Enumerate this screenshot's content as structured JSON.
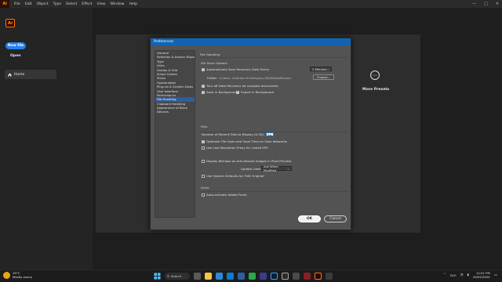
{
  "app": {
    "logo": "Ai",
    "menu": [
      "File",
      "Edit",
      "Object",
      "Type",
      "Select",
      "Effect",
      "View",
      "Window",
      "Help"
    ],
    "window_controls": [
      "—",
      "□",
      "✕"
    ]
  },
  "home": {
    "badge": "Ai",
    "new_file": "New file",
    "open": "Open",
    "nav_home": "Home",
    "more_presets": "More Presets",
    "more_presets_glyph": "•••"
  },
  "dialog": {
    "title": "Preferences",
    "categories": [
      "General",
      "Selection & Anchor Display",
      "Type",
      "Units",
      "Guides & Grid",
      "Smart Guides",
      "Slices",
      "Hyphenation",
      "Plug-ins & Scratch Disks",
      "User Interface",
      "Performance",
      "File Handling",
      "Clipboard Handling",
      "Appearance of Black",
      "Devices"
    ],
    "selected_category": "File Handling",
    "section_title": "File Handling",
    "file_save_options": {
      "heading": "File Save Options",
      "auto_save_label": "Automatically Save Recovery Data Every:",
      "auto_save_checked": true,
      "interval_value": "2 Minutes",
      "folder_label": "Folder:",
      "folder_path": "C:\\Users\\...\\Illustrator 26 Settings\\en_GB\\x64\\DataRecovery",
      "choose_button": "Choose...",
      "turn_off_label": "Turn off Data Recovery for complex documents",
      "turn_off_checked": true,
      "save_background_label": "Save in Background",
      "save_background_checked": true,
      "export_background_label": "Export in Background",
      "export_background_checked": true
    },
    "files": {
      "heading": "Files",
      "recent_files_label": "Number of Recent Files to Display (0-30):",
      "recent_files_value": "20",
      "optimize_label": "Optimize File Open and Save Time on Slow Networks",
      "optimize_checked": true,
      "low_res_label": "Use Low Resolution Proxy for Linked EPS",
      "low_res_checked": false,
      "bitmaps_label": "Display Bitmaps as Anti-Aliased images in Pixel Preview",
      "bitmaps_checked": false,
      "update_links_label": "Update Links:",
      "update_links_value": "Ask When Modified",
      "system_defaults_label": "Use System Defaults for 'Edit Original'",
      "system_defaults_checked": false
    },
    "fonts": {
      "heading": "Fonts",
      "auto_activate_label": "Auto-activate Adobe Fonts",
      "auto_activate_checked": false
    },
    "ok_label": "OK",
    "cancel_label": "Cancel"
  },
  "taskbar": {
    "temperature": "29°C",
    "weather": "Mostly sunny",
    "search": "Search",
    "time": "12:01 PM",
    "date": "29/02/2024",
    "lang": "ENG"
  },
  "colors": {
    "accent": "#2680eb",
    "title_bar": "#0f64b4",
    "selection": "#2c5ea0",
    "illustrator_orange": "#ff9a00"
  }
}
